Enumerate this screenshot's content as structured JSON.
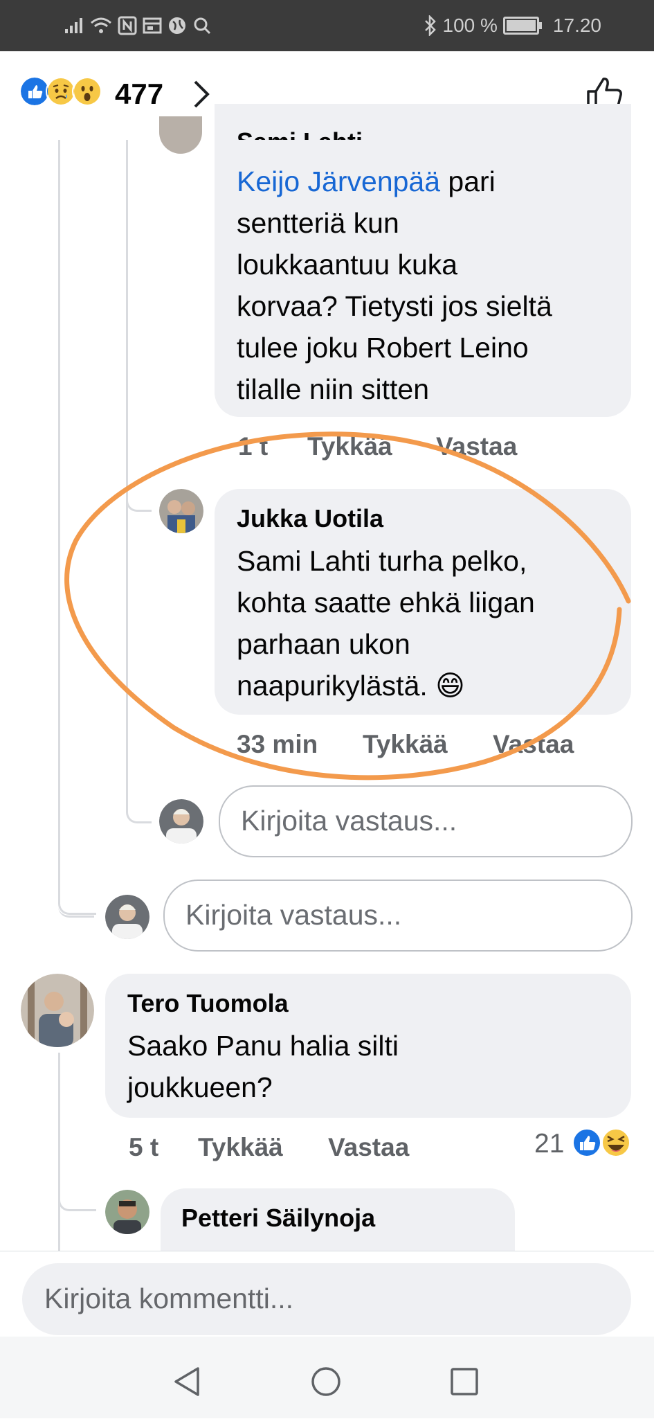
{
  "status_bar": {
    "icons_left": [
      "signal-icon",
      "wifi-icon",
      "nfc-icon",
      "sim-icon",
      "globe-icon",
      "search-icon"
    ],
    "bluetooth": "bluetooth-icon",
    "battery": "100 %",
    "time": "17.20"
  },
  "header": {
    "reactions": [
      "like",
      "sad",
      "wow"
    ],
    "reaction_count": "477",
    "like_icon": "thumbs-up-outline-icon"
  },
  "comments": {
    "sami": {
      "name": "Sami Lahti",
      "mention": "Keijo Järvenpää",
      "lines": [
        " pari",
        "sentteriä kun",
        "loukkaantuu kuka",
        "korvaa? Tietysti jos sieltä",
        "tulee joku Robert Leino",
        "tilalle niin sitten"
      ],
      "time": "1 t",
      "like": "Tykkää",
      "reply": "Vastaa"
    },
    "jukka": {
      "name": "Jukka Uotila",
      "lines": [
        "Sami Lahti turha pelko,",
        "kohta saatte ehkä liigan",
        "parhaan ukon",
        "naapurikylästä. 😄"
      ],
      "time": "33 min",
      "like": "Tykkää",
      "reply": "Vastaa"
    },
    "reply_input_placeholder": "Kirjoita vastaus...",
    "reply_input_placeholder_2": "Kirjoita vastaus...",
    "tero": {
      "name": "Tero Tuomola",
      "lines": [
        "Saako Panu halia silti",
        "joukkueen?"
      ],
      "time": "5 t",
      "like": "Tykkää",
      "reply": "Vastaa",
      "reaction_count": "21"
    },
    "petteri": {
      "name": "Petteri Säilynoja"
    }
  },
  "composer": {
    "placeholder": "Kirjoita kommentti..."
  },
  "nav": {
    "back": "back-triangle-icon",
    "home": "home-circle-icon",
    "recents": "recents-square-icon"
  },
  "colors": {
    "status_bar": "#3b3b3b",
    "bubble": "#eff0f3",
    "link": "#1767d4",
    "highlight_circle": "#f39a4c"
  }
}
